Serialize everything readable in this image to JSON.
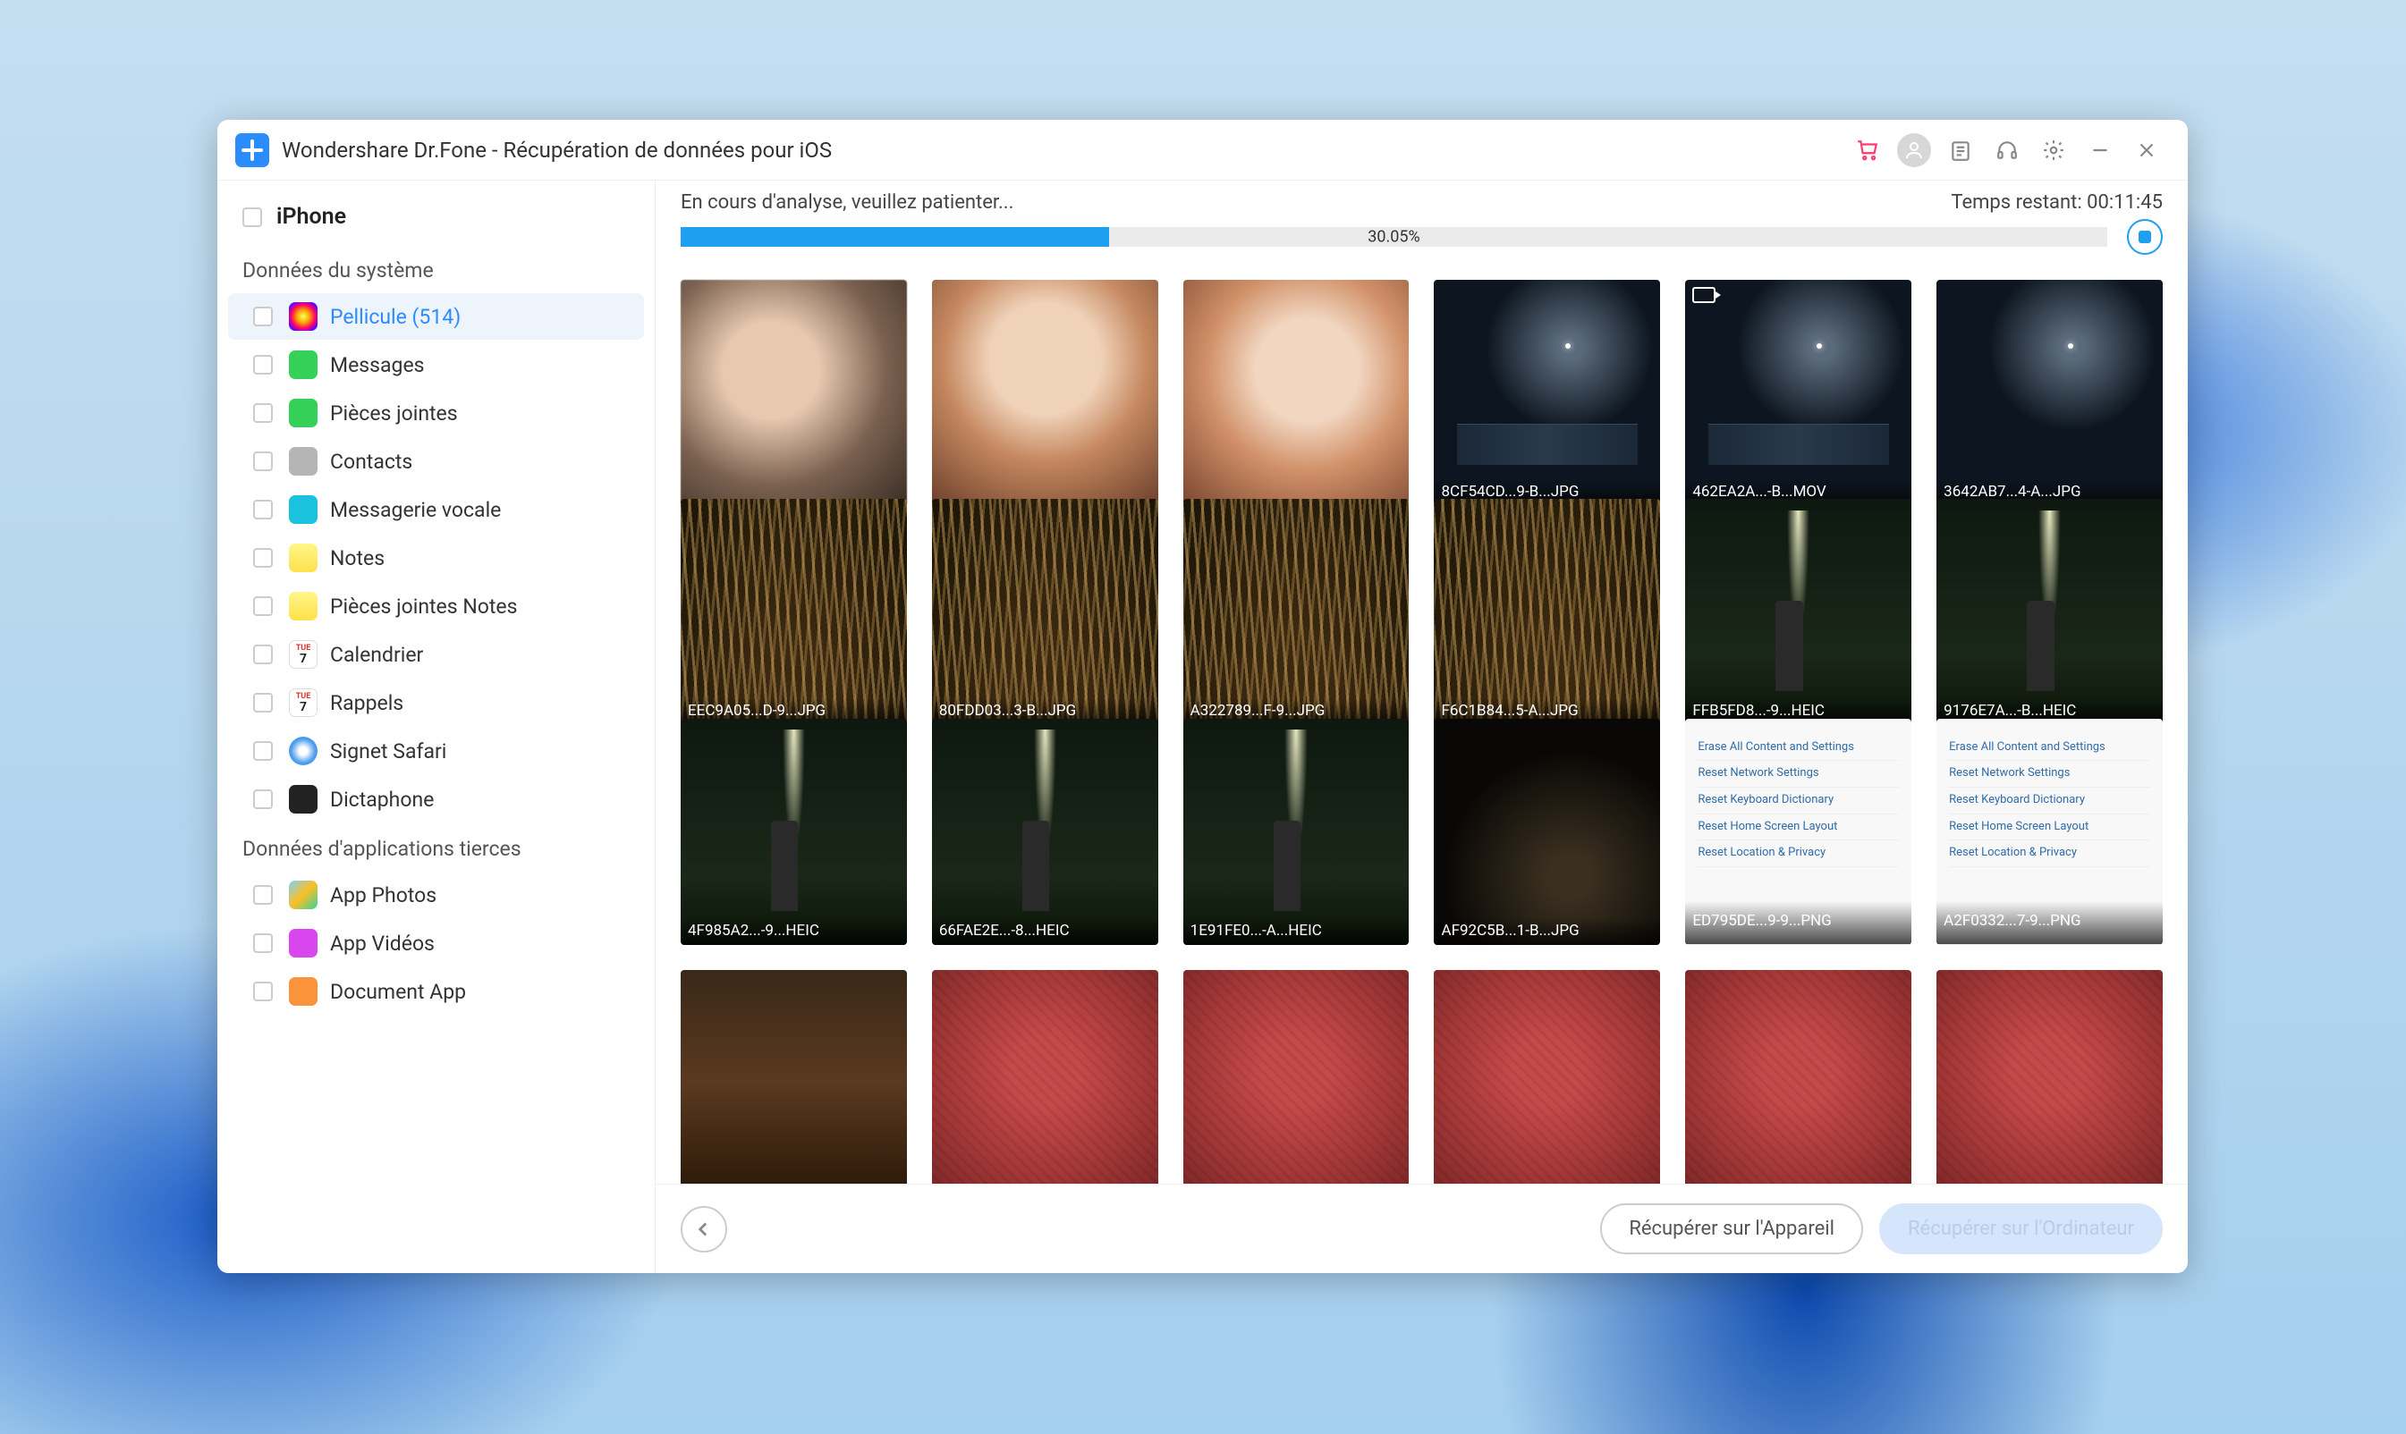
{
  "title": "Wondershare Dr.Fone - Récupération de données pour iOS",
  "device": "iPhone",
  "sections": {
    "system": "Données du système",
    "thirdparty": "Données d'applications tierces"
  },
  "sidebar_system": [
    {
      "id": "pellicule",
      "label": "Pellicule (514)",
      "icon": "ico-photos",
      "active": true
    },
    {
      "id": "messages",
      "label": "Messages",
      "icon": "ico-green"
    },
    {
      "id": "attachments",
      "label": "Pièces jointes",
      "icon": "ico-green"
    },
    {
      "id": "contacts",
      "label": "Contacts",
      "icon": "ico-grey"
    },
    {
      "id": "voicemail",
      "label": "Messagerie vocale",
      "icon": "ico-cyan"
    },
    {
      "id": "notes",
      "label": "Notes",
      "icon": "ico-notes"
    },
    {
      "id": "notes-attach",
      "label": "Pièces jointes Notes",
      "icon": "ico-notes"
    },
    {
      "id": "calendar",
      "label": "Calendrier",
      "icon": "ico-cal"
    },
    {
      "id": "reminders",
      "label": "Rappels",
      "icon": "ico-cal"
    },
    {
      "id": "safari",
      "label": "Signet Safari",
      "icon": "ico-safari"
    },
    {
      "id": "dictaphone",
      "label": "Dictaphone",
      "icon": "ico-dicta"
    }
  ],
  "sidebar_tp": [
    {
      "id": "app-photos",
      "label": "App Photos",
      "icon": "ico-apx"
    },
    {
      "id": "app-videos",
      "label": "App Vidéos",
      "icon": "ico-apv"
    },
    {
      "id": "app-doc",
      "label": "Document App",
      "icon": "ico-doc"
    }
  ],
  "progress": {
    "status": "En cours d'analyse, veuillez patienter...",
    "pct_label": "30.05%",
    "pct": 30.05,
    "time_label": "Temps restant: 00:11:45"
  },
  "thumbs": [
    {
      "cls": "t-blur1",
      "label": ""
    },
    {
      "cls": "t-blur2",
      "label": ""
    },
    {
      "cls": "t-blur3",
      "label": ""
    },
    {
      "cls": "t-night t-night-bldg",
      "label": "8CF54CD...9-B...JPG"
    },
    {
      "cls": "t-night t-night-bldg",
      "label": "462EA2A...-B...MOV",
      "video": true
    },
    {
      "cls": "t-night",
      "label": "3642AB7...4-A...JPG"
    },
    {
      "cls": "t-grass",
      "label": "EEC9A05...D-9...JPG"
    },
    {
      "cls": "t-grass",
      "label": "80FDD03...3-B...JPG"
    },
    {
      "cls": "t-grass",
      "label": "A322789...F-9...JPG"
    },
    {
      "cls": "t-grass",
      "label": "F6C1B84...5-A...JPG"
    },
    {
      "cls": "t-nightpark",
      "label": "FFB5FD8...-9...HEIC"
    },
    {
      "cls": "t-nightpark",
      "label": "9176E7A...-B...HEIC"
    },
    {
      "cls": "t-nightpark",
      "label": "4F985A2...-9...HEIC"
    },
    {
      "cls": "t-nightpark",
      "label": "66FAE2E...-8...HEIC"
    },
    {
      "cls": "t-nightpark",
      "label": "1E91FE0...-A...HEIC"
    },
    {
      "cls": "t-darkpopcorn",
      "label": "AF92C5B...1-B...JPG"
    },
    {
      "cls": "t-settings",
      "label": "ED795DE...9-9...PNG",
      "settings": true
    },
    {
      "cls": "t-settings",
      "label": "A2F0332...7-9...PNG",
      "settings": true
    },
    {
      "cls": "t-person",
      "label": ""
    },
    {
      "cls": "t-red",
      "label": ""
    },
    {
      "cls": "t-red",
      "label": ""
    },
    {
      "cls": "t-red",
      "label": ""
    },
    {
      "cls": "t-red",
      "label": ""
    },
    {
      "cls": "t-red",
      "label": ""
    }
  ],
  "settings_lines": [
    "Erase All Content and Settings",
    "Reset Network Settings",
    "Reset Keyboard Dictionary",
    "Reset Home Screen Layout",
    "Reset Location & Privacy"
  ],
  "footer": {
    "recover_device": "Récupérer sur l'Appareil",
    "recover_pc": "Récupérer sur l'Ordinateur"
  },
  "cal_day": "7",
  "cal_month": "TUE"
}
